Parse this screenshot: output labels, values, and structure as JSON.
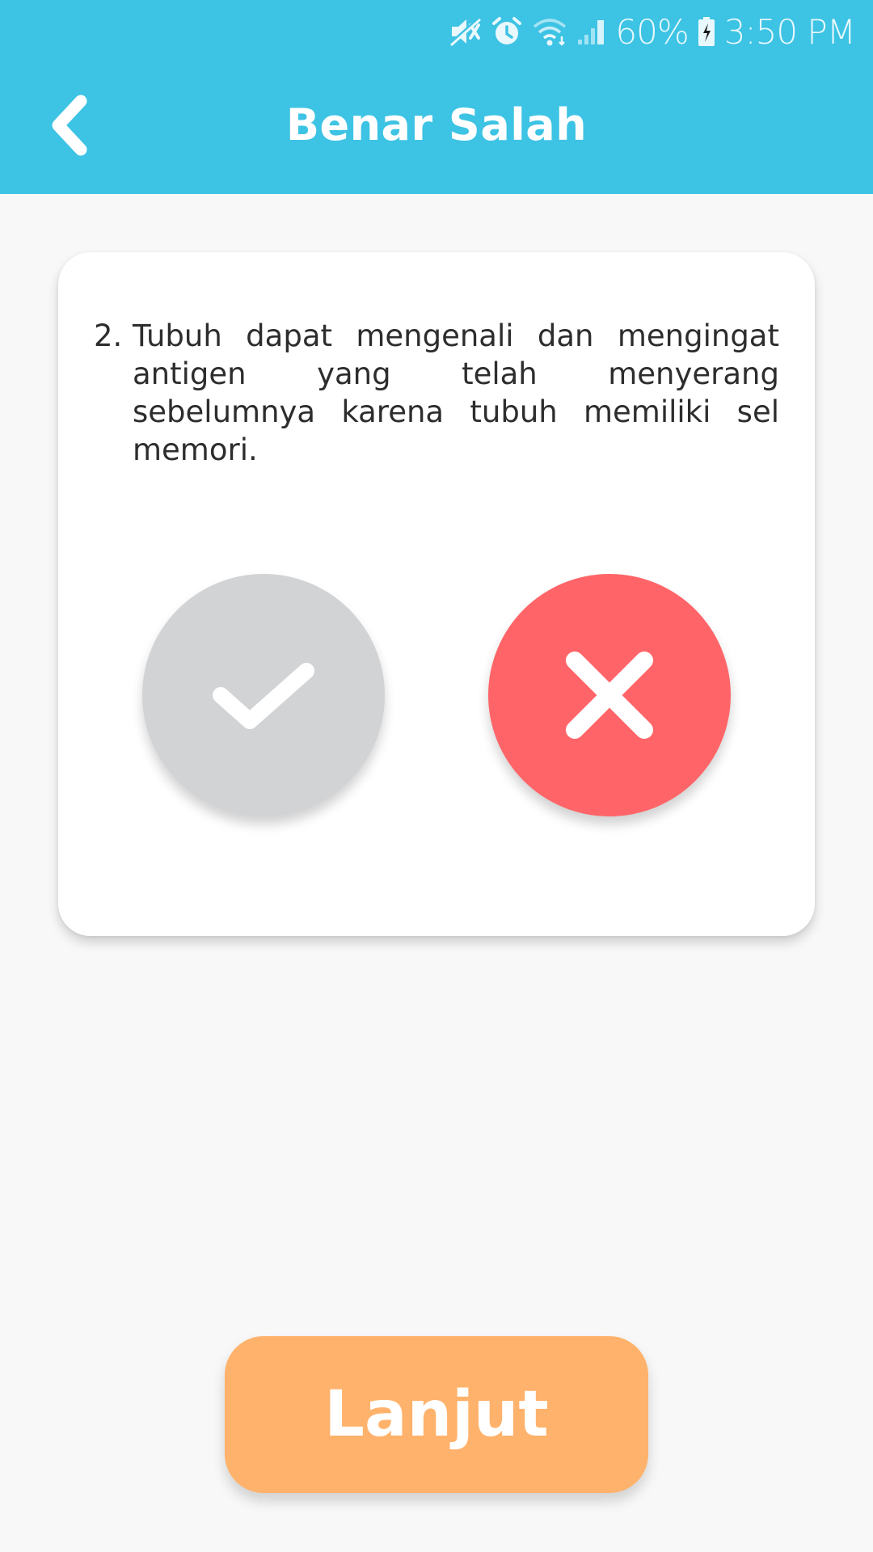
{
  "status_bar": {
    "icons": [
      "mute-icon",
      "alarm-icon",
      "wifi-icon",
      "signal-icon",
      "battery-charging-icon"
    ],
    "battery_percent": "60%",
    "time": "3:50 PM"
  },
  "header": {
    "title": "Benar Salah",
    "back_icon": "chevron-left-icon",
    "background_color": "#3dc3e4"
  },
  "question": {
    "number": "2.",
    "text": "Tubuh dapat mengenali dan mengingat antigen yang telah menyerang sebelumnya karena tubuh memiliki sel memori."
  },
  "answers": {
    "true_button": {
      "icon": "check-icon",
      "color": "#d2d3d5",
      "selected": false
    },
    "false_button": {
      "icon": "close-icon",
      "color": "#ff6568",
      "selected": true
    }
  },
  "footer": {
    "next_label": "Lanjut",
    "next_color": "#ffb26b"
  }
}
